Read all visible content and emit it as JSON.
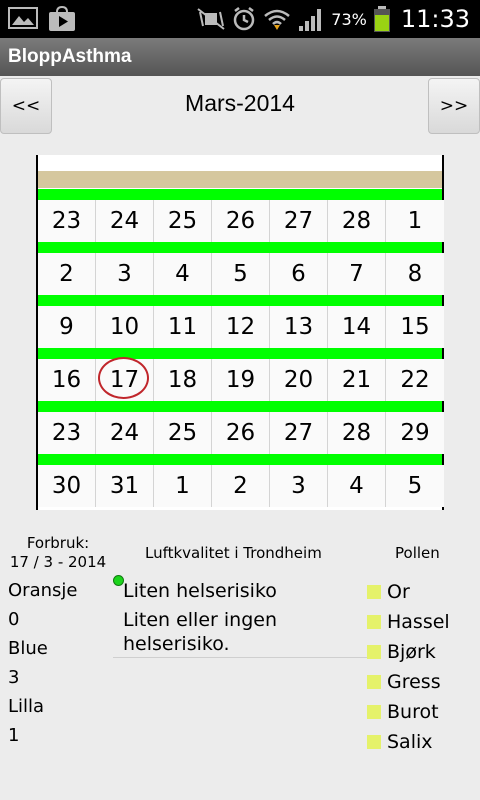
{
  "statusbar": {
    "battery_text": "73%",
    "time": "11:33"
  },
  "app": {
    "title": "BloppAsthma"
  },
  "header": {
    "prev_label": "<<",
    "next_label": ">>",
    "month_title": "Mars-2014"
  },
  "calendar": {
    "weeks": [
      [
        "23",
        "24",
        "25",
        "26",
        "27",
        "28",
        "1"
      ],
      [
        "2",
        "3",
        "4",
        "5",
        "6",
        "7",
        "8"
      ],
      [
        "9",
        "10",
        "11",
        "12",
        "13",
        "14",
        "15"
      ],
      [
        "16",
        "17",
        "18",
        "19",
        "20",
        "21",
        "22"
      ],
      [
        "23",
        "24",
        "25",
        "26",
        "27",
        "28",
        "29"
      ],
      [
        "30",
        "31",
        "1",
        "2",
        "3",
        "4",
        "5"
      ]
    ],
    "today": "17",
    "colors": {
      "week_bar": "#00ff00",
      "header_band": "#d5c79e",
      "today_ring": "#c0262b"
    }
  },
  "usage": {
    "title_line1": "Forbruk:",
    "title_line2": "17 / 3 - 2014",
    "items": [
      {
        "name": "Oransje",
        "value": "0"
      },
      {
        "name": "Blue",
        "value": "3"
      },
      {
        "name": "Lilla",
        "value": "1"
      }
    ]
  },
  "air": {
    "title": "Luftkvalitet i Trondheim",
    "line1": "Liten helserisiko",
    "line2": "Liten eller ingen helserisiko.",
    "indicator_color": "#1bd41b"
  },
  "pollen": {
    "title": "Pollen",
    "items": [
      "Or",
      "Hassel",
      "Bjørk",
      "Gress",
      "Burot",
      "Salix"
    ],
    "swatch_color": "#e5f26a"
  }
}
